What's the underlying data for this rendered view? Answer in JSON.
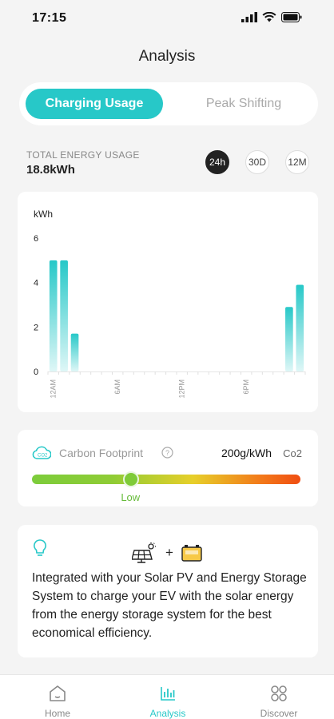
{
  "status": {
    "time": "17:15"
  },
  "page": {
    "title": "Analysis"
  },
  "tabs": [
    {
      "label": "Charging Usage",
      "active": true
    },
    {
      "label": "Peak Shifting",
      "active": false
    }
  ],
  "usage": {
    "label": "TOTAL ENERGY USAGE",
    "value": "18.8kWh",
    "ranges": [
      {
        "label": "24h",
        "active": true
      },
      {
        "label": "30D",
        "active": false
      },
      {
        "label": "12M",
        "active": false
      }
    ]
  },
  "chart_data": {
    "type": "bar",
    "ylabel": "kWh",
    "ylim": [
      0,
      6
    ],
    "yticks": [
      "6",
      "4",
      "2",
      "0"
    ],
    "xticks": [
      "12AM",
      "6AM",
      "12PM",
      "6PM"
    ],
    "xtick_hours": [
      0,
      6,
      12,
      18
    ],
    "hours": [
      0,
      1,
      2,
      22,
      23
    ],
    "values": [
      5,
      5,
      1.7,
      2.9,
      3.9
    ],
    "grid": false,
    "bar_color": "#27c8c8"
  },
  "carbon": {
    "label": "Carbon Footprint",
    "value": "200g/kWh",
    "unit": "Co2",
    "level_label": "Low",
    "level_fraction": 0.37
  },
  "info": {
    "text": "Integrated with your Solar PV and Energy Storage System to charge your EV with the solar energy from the energy storage system for the best economical efficiency."
  },
  "nav": [
    {
      "label": "Home",
      "icon": "home-icon",
      "active": false
    },
    {
      "label": "Analysis",
      "icon": "bar-chart-icon",
      "active": true
    },
    {
      "label": "Discover",
      "icon": "discover-grid-icon",
      "active": false
    }
  ],
  "colors": {
    "accent": "#27c8c8",
    "low": "#66bb3a",
    "high": "#f04e12"
  }
}
